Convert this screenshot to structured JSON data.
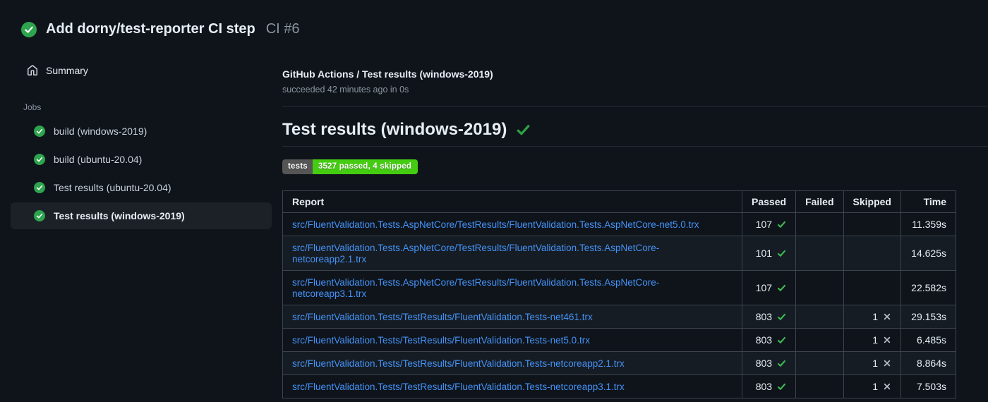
{
  "colors": {
    "page_bg": "#0f141b",
    "success_green": "#2ea44f",
    "check_green": "#3fb950",
    "link_blue": "#4493f8",
    "badge_label_bg": "#555555",
    "badge_value_bg": "#44cc11",
    "selected_item_bg": "#1c2128",
    "muted_text": "#8b949e"
  },
  "run_header": {
    "title": "Add dorny/test-reporter CI step",
    "run_number": "CI #6"
  },
  "sidebar": {
    "summary_label": "Summary",
    "jobs_section_label": "Jobs",
    "jobs": [
      {
        "label": "build (windows-2019)",
        "status": "success",
        "selected": false
      },
      {
        "label": "build (ubuntu-20.04)",
        "status": "success",
        "selected": false
      },
      {
        "label": "Test results (ubuntu-20.04)",
        "status": "success",
        "selected": false
      },
      {
        "label": "Test results (windows-2019)",
        "status": "success",
        "selected": true
      }
    ]
  },
  "main": {
    "suite_title": "GitHub Actions / Test results (windows-2019)",
    "suite_subtitle": "succeeded 42 minutes ago in 0s",
    "heading": "Test results (windows-2019)",
    "badge": {
      "label": "tests",
      "value": "3527 passed, 4 skipped"
    },
    "table": {
      "columns": [
        "Report",
        "Passed",
        "Failed",
        "Skipped",
        "Time"
      ],
      "rows": [
        {
          "report": "src/FluentValidation.Tests.AspNetCore/TestResults/FluentValidation.Tests.AspNetCore-net5.0.trx",
          "passed": "107",
          "failed": "",
          "skipped": "",
          "time": "11.359s"
        },
        {
          "report": "src/FluentValidation.Tests.AspNetCore/TestResults/FluentValidation.Tests.AspNetCore-netcoreapp2.1.trx",
          "passed": "101",
          "failed": "",
          "skipped": "",
          "time": "14.625s"
        },
        {
          "report": "src/FluentValidation.Tests.AspNetCore/TestResults/FluentValidation.Tests.AspNetCore-netcoreapp3.1.trx",
          "passed": "107",
          "failed": "",
          "skipped": "",
          "time": "22.582s"
        },
        {
          "report": "src/FluentValidation.Tests/TestResults/FluentValidation.Tests-net461.trx",
          "passed": "803",
          "failed": "",
          "skipped": "1",
          "time": "29.153s"
        },
        {
          "report": "src/FluentValidation.Tests/TestResults/FluentValidation.Tests-net5.0.trx",
          "passed": "803",
          "failed": "",
          "skipped": "1",
          "time": "6.485s"
        },
        {
          "report": "src/FluentValidation.Tests/TestResults/FluentValidation.Tests-netcoreapp2.1.trx",
          "passed": "803",
          "failed": "",
          "skipped": "1",
          "time": "8.864s"
        },
        {
          "report": "src/FluentValidation.Tests/TestResults/FluentValidation.Tests-netcoreapp3.1.trx",
          "passed": "803",
          "failed": "",
          "skipped": "1",
          "time": "7.503s"
        }
      ]
    }
  }
}
